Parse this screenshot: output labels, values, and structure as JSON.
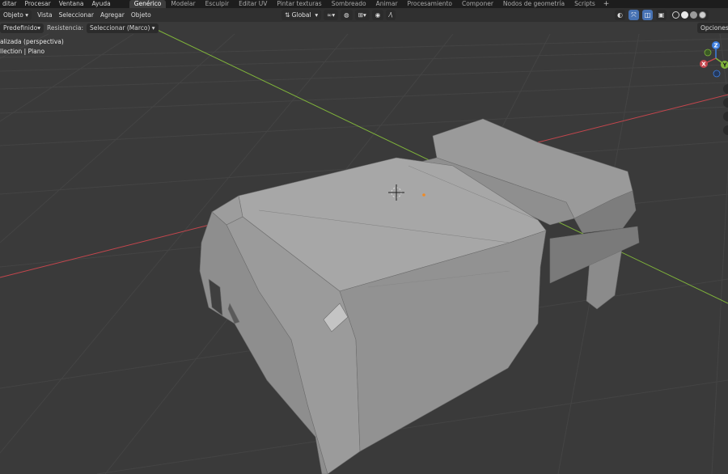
{
  "topbar": {
    "menus": [
      "ditar",
      "Procesar",
      "Ventana",
      "Ayuda"
    ],
    "tabs": [
      {
        "label": "Genérico",
        "active": true
      },
      {
        "label": "Modelar",
        "active": false
      },
      {
        "label": "Esculpir",
        "active": false
      },
      {
        "label": "Editar UV",
        "active": false
      },
      {
        "label": "Pintar texturas",
        "active": false
      },
      {
        "label": "Sombreado",
        "active": false
      },
      {
        "label": "Animar",
        "active": false
      },
      {
        "label": "Procesamiento",
        "active": false
      },
      {
        "label": "Componer",
        "active": false
      },
      {
        "label": "Nodos de geometría",
        "active": false
      },
      {
        "label": "Scripts",
        "active": false
      }
    ],
    "add_tab": "+"
  },
  "header": {
    "mode_label": "Objeto",
    "menus": [
      "Vista",
      "Seleccionar",
      "Agregar",
      "Objeto"
    ],
    "orientation_label": "Global",
    "right_icons": [
      "visibility-icon",
      "gizmo-icon",
      "overlay-icon",
      "xray-icon"
    ],
    "shading_modes": [
      "wireframe",
      "solid",
      "material",
      "rendered"
    ]
  },
  "toolbar": {
    "transform_label": "Predefinido",
    "drag_label": "Resistencia:",
    "select_value": "Seleccionar (Marco)",
    "options_label": "Opciones"
  },
  "viewport": {
    "view_name": "alizada (perspectiva)",
    "collection_info": "llection | Plano",
    "gizmo_axes": [
      "Z",
      "Y",
      "X"
    ]
  },
  "colors": {
    "axis_x": "#c4464d",
    "axis_y": "#7fb33a",
    "axis_z": "#3d7ee0",
    "accent": "#4772b3",
    "mesh": "#9c9c9c"
  }
}
